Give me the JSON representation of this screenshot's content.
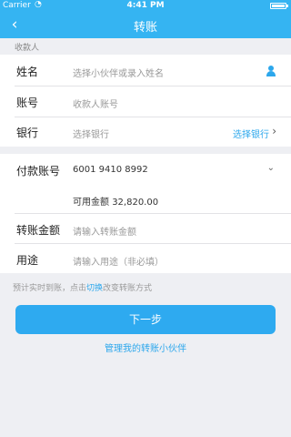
{
  "status": {
    "carrier": "Carrier",
    "time": "4:41 PM"
  },
  "nav": {
    "title": "转账",
    "back_glyph": "‹"
  },
  "payee": {
    "section_label": "收款人",
    "name_label": "姓名",
    "name_placeholder": "选择小伙伴或录入姓名",
    "account_label": "账号",
    "account_placeholder": "收款人账号",
    "bank_label": "银行",
    "bank_placeholder": "选择银行",
    "bank_link": "选择银行",
    "icon": "user-icon"
  },
  "payer": {
    "account_label": "付款账号",
    "account_value": "6001 9410 8992",
    "balance_label": "可用金额",
    "balance_value": "32,820.00",
    "amount_label": "转账金额",
    "amount_placeholder": "请输入转账金额",
    "purpose_label": "用途",
    "purpose_placeholder": "请输入用途（非必填）"
  },
  "hint": {
    "prefix": "预计实时到账，点击",
    "switch": "切换",
    "suffix": "改变转账方式"
  },
  "actions": {
    "next": "下一步",
    "manage": "管理我的转账小伙伴"
  },
  "colors": {
    "accent": "#35b4f2",
    "link": "#2ca7ec"
  }
}
